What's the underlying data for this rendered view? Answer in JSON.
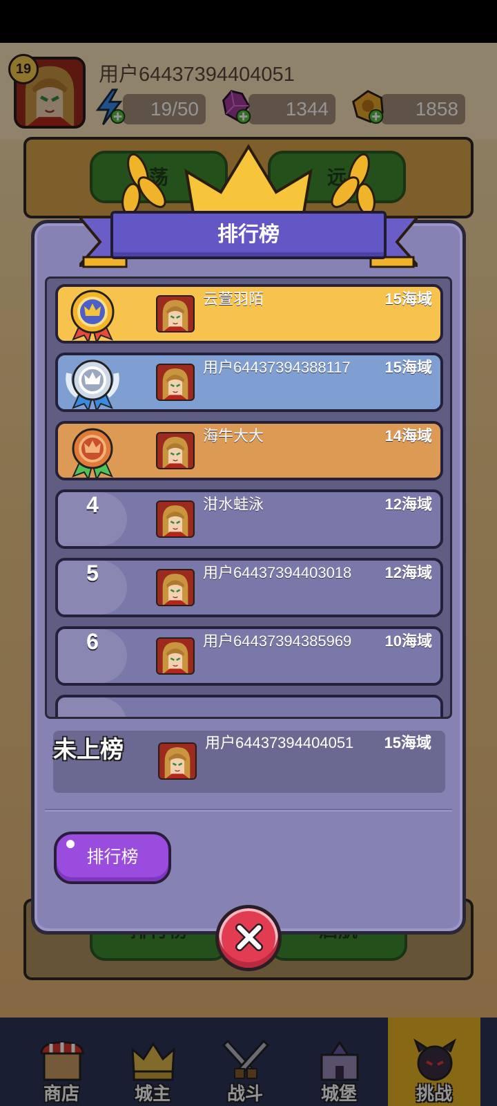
{
  "player": {
    "level": "19",
    "username": "用户64437394404051",
    "energy": "19/50",
    "gems": "1344",
    "coins": "1858"
  },
  "background_buttons": {
    "left_top": "荡",
    "right_top": "远",
    "left_bottom": "排行榜",
    "right_bottom": "启航"
  },
  "leaderboard": {
    "title": "排行榜",
    "entries": [
      {
        "rank": "1",
        "name": "云萱羽陌",
        "score": "15海域",
        "medal": "gold"
      },
      {
        "rank": "2",
        "name": "用户64437394388117",
        "score": "15海域",
        "medal": "silver"
      },
      {
        "rank": "3",
        "name": "海牛大大",
        "score": "14海域",
        "medal": "bronze"
      },
      {
        "rank": "4",
        "name": "泔水蛙泳",
        "score": "12海域"
      },
      {
        "rank": "5",
        "name": "用户64437394403018",
        "score": "12海域"
      },
      {
        "rank": "6",
        "name": "用户64437394385969",
        "score": "10海域"
      }
    ],
    "self": {
      "rank_label": "未上榜",
      "name": "用户64437394404051",
      "score": "15海域"
    },
    "button_label": "排行榜"
  },
  "nav": {
    "tabs": [
      {
        "label": "商店",
        "icon": "shop-icon"
      },
      {
        "label": "城主",
        "icon": "crown-icon"
      },
      {
        "label": "战斗",
        "icon": "swords-icon"
      },
      {
        "label": "城堡",
        "icon": "castle-icon"
      },
      {
        "label": "挑战",
        "icon": "demon-icon",
        "active": true
      }
    ]
  },
  "colors": {
    "gold": "#f7c34c",
    "silver": "#7f9fd3",
    "bronze": "#dd9a55",
    "panel": "#8683b4",
    "title_bar": "#6356c5",
    "close": "#e23c52",
    "button": "#9a4cdf"
  }
}
